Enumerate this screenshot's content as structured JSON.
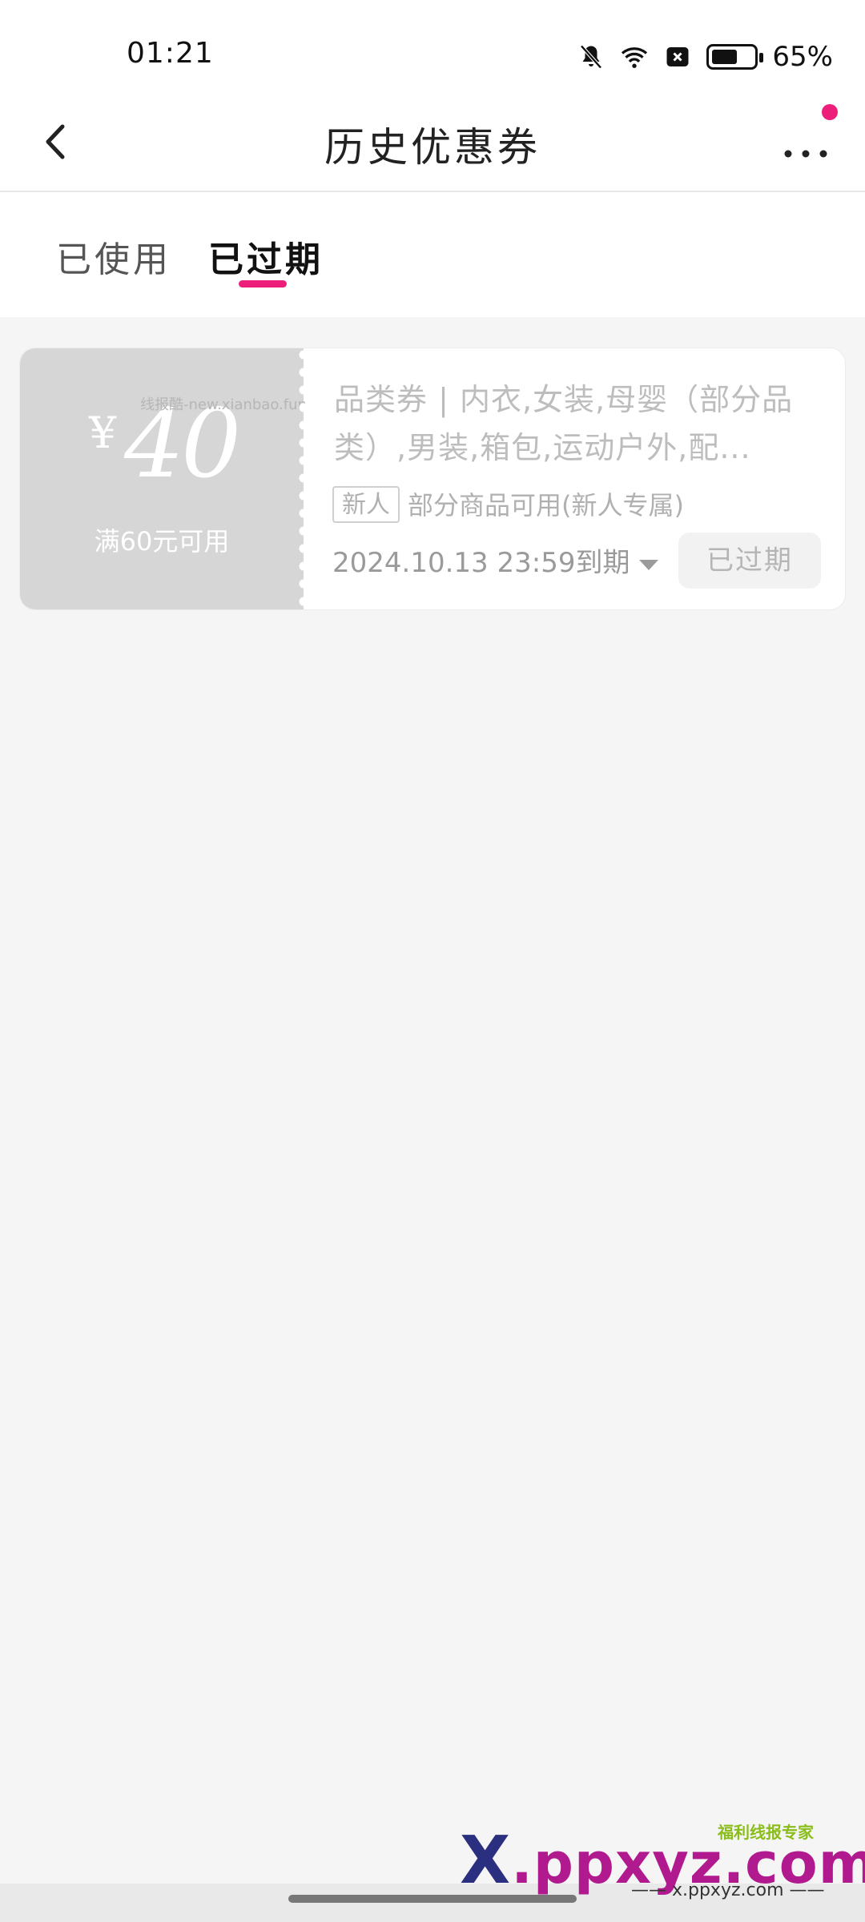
{
  "status_bar": {
    "time": "01:21",
    "battery_percent_text": "65%",
    "battery_level": 0.65,
    "icons": [
      "bell-muted-icon",
      "wifi-icon",
      "sim-off-icon",
      "battery-icon"
    ]
  },
  "nav": {
    "title": "历史优惠券",
    "back_icon": "chevron-left-icon",
    "more_icon": "more-dots-icon",
    "badge_color": "#ec1e7a"
  },
  "tabs": [
    {
      "label": "已使用",
      "selected": false
    },
    {
      "label": "已过期",
      "selected": true
    }
  ],
  "coupon": {
    "currency": "¥",
    "amount": "40",
    "condition": "满60元可用",
    "watermark": "线报酷-new.xianbao.fun",
    "title": "品类券 | 内衣,女装,母婴（部分品类）,男装,箱包,运动户外,配...",
    "tag": "新人",
    "scope": "部分商品可用(新人专属)",
    "expire": "2024.10.13 23:59到期",
    "status_button": "已过期"
  },
  "watermark": {
    "logo_x": "X",
    "logo_rest": ".ppxyz.com",
    "sub": "福利线报专家",
    "url": "—— x.ppxyz.com ——"
  },
  "colors": {
    "accent": "#ec1e7a",
    "coupon_left_bg": "#d6d6d6"
  }
}
